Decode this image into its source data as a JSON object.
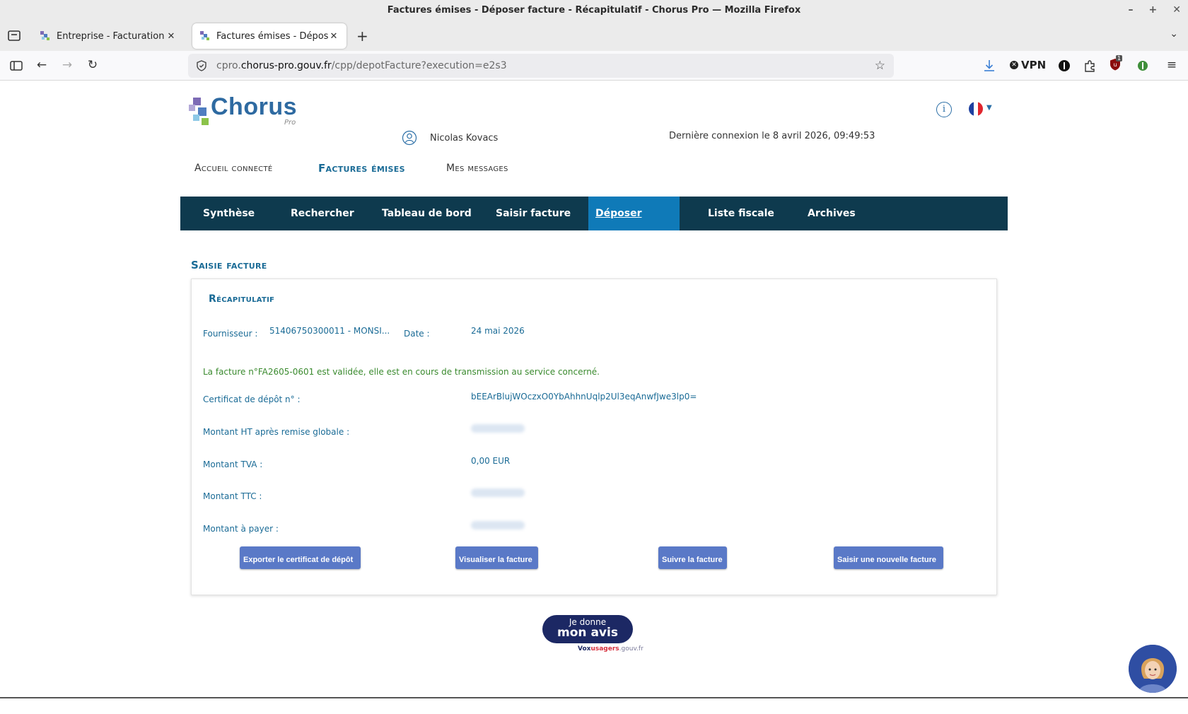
{
  "window": {
    "title": "Factures émises - Déposer facture - Récapitulatif - Chorus Pro — Mozilla Firefox"
  },
  "tabs": [
    {
      "title": "Entreprise - Facturation - Portail Chorus Pro",
      "active": false
    },
    {
      "title": "Factures émises - Déposer facture - Récapitulatif",
      "active": true
    }
  ],
  "urlbar": {
    "prefix": "cpro.",
    "host": "chorus-pro.gouv.fr",
    "path": "/cpp/depotFacture?execution=e2s3"
  },
  "toolbar": {
    "vpn_label": "VPN",
    "badge_count": "1"
  },
  "header": {
    "logo_text": "Chorus",
    "logo_sub": "Pro",
    "user_name": "Nicolas Kovacs",
    "last_login": "Dernière connexion le 8 avril 2026, 09:49:53"
  },
  "top_nav": [
    {
      "label": "Accueil connecté",
      "active": false
    },
    {
      "label": "Factures émises",
      "active": true
    },
    {
      "label": "Mes messages",
      "active": false
    }
  ],
  "sub_nav": [
    {
      "label": "Synthèse"
    },
    {
      "label": "Rechercher"
    },
    {
      "label": "Tableau de bord"
    },
    {
      "label": "Saisir facture"
    },
    {
      "label": "Déposer facture",
      "active": true
    },
    {
      "label": "Liste fiscale"
    },
    {
      "label": "Archives"
    }
  ],
  "section_title": "Saisie facture",
  "recap": {
    "title": "Récapitulatif",
    "supplier_label": "Fournisseur :",
    "supplier_value": "51406750300011 - MONSI...",
    "date_label": "Date :",
    "date_value": "24 mai 2026",
    "success_message": "La facture n°FA2605-0601 est validée, elle est en cours de transmission au service concerné.",
    "certificate_label": "Certificat de dépôt n° :",
    "certificate_value": "bEEArBlujWOczxO0YbAhhnUqlp2Ul3eqAnwfJwe3lp0=",
    "amount_ht_label": "Montant HT après remise globale :",
    "tva_label": "Montant TVA :",
    "tva_value": "0,00 EUR",
    "ttc_label": "Montant TTC :",
    "to_pay_label": "Montant à payer :"
  },
  "actions": {
    "export_label": "Exporter le certificat de dépôt",
    "view_label": "Visualiser la facture",
    "follow_label": "Suivre la facture",
    "new_label": "Saisir une nouvelle facture"
  },
  "feedback": {
    "line1": "Je donne",
    "line2": "mon avis",
    "vox_prefix": "Vox",
    "vox_red": "usagers",
    "vox_suffix": ".gouv.fr"
  },
  "colors": {
    "brand_blue": "#1a6b96",
    "subnav_bg": "#0e3a4e",
    "subnav_active": "#0f7ab8",
    "button_bg": "#5a79c7",
    "success_green": "#3a8a2e"
  }
}
